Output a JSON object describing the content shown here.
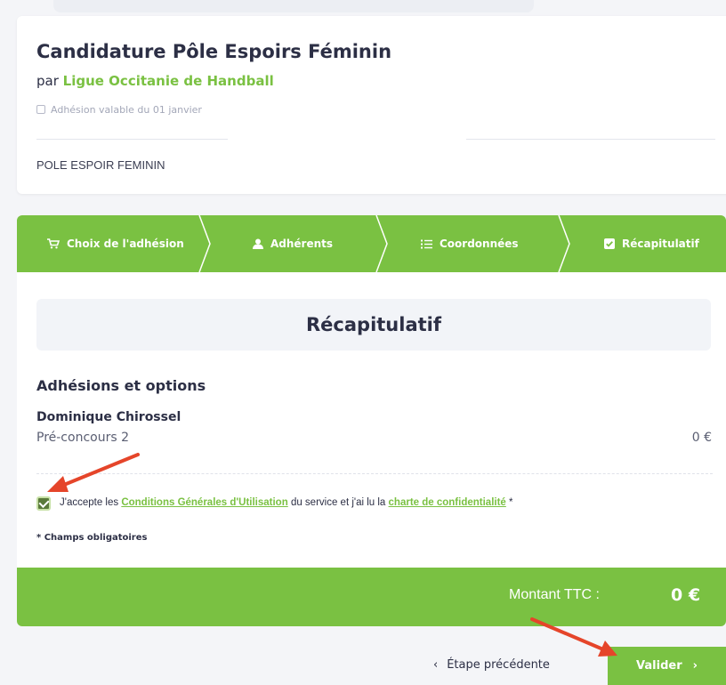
{
  "header": {
    "title": "Candidature Pôle Espoirs Féminin",
    "by_prefix": "par",
    "organization": "Ligue Occitanie de Handball",
    "validity": "Adhésion valable du 01 janvier",
    "category": "POLE ESPOIR FEMININ"
  },
  "steps": [
    {
      "label": "Choix de l'adhésion",
      "icon": "cart-icon"
    },
    {
      "label": "Adhérents",
      "icon": "user-icon"
    },
    {
      "label": "Coordonnées",
      "icon": "list-icon"
    },
    {
      "label": "Récapitulatif",
      "icon": "checkbox-icon"
    }
  ],
  "recap": {
    "heading": "Récapitulatif",
    "section_title": "Adhésions et options",
    "member_name": "Dominique Chirossel",
    "member_option": "Pré-concours 2",
    "member_price": "0 €"
  },
  "terms": {
    "checked": true,
    "text_1": "J'accepte les",
    "link_cgu": "Conditions Générales d'Utilisation",
    "text_2": "du service et j'ai lu la",
    "link_privacy": "charte de confidentialité",
    "text_3": "*"
  },
  "mandatory_note": "* Champs obligatoires",
  "total": {
    "label": "Montant TTC :",
    "value": "0 €"
  },
  "nav": {
    "prev_label": "Étape précédente",
    "next_label": "Valider"
  },
  "colors": {
    "accent": "#7ac142",
    "annotation_arrow": "#e5452a"
  }
}
